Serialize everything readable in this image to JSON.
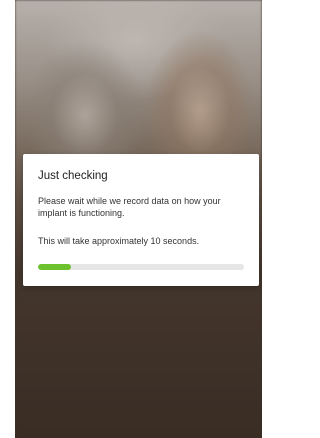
{
  "dialog": {
    "title": "Just checking",
    "message": "Please wait while we record data on how your implant is functioning.",
    "duration_note": "This will take approximately 10 seconds.",
    "progress_percent": 16
  },
  "colors": {
    "progress_fill": "#6cc12c",
    "progress_track": "#e6e6e6",
    "modal_background": "#ffffff"
  }
}
